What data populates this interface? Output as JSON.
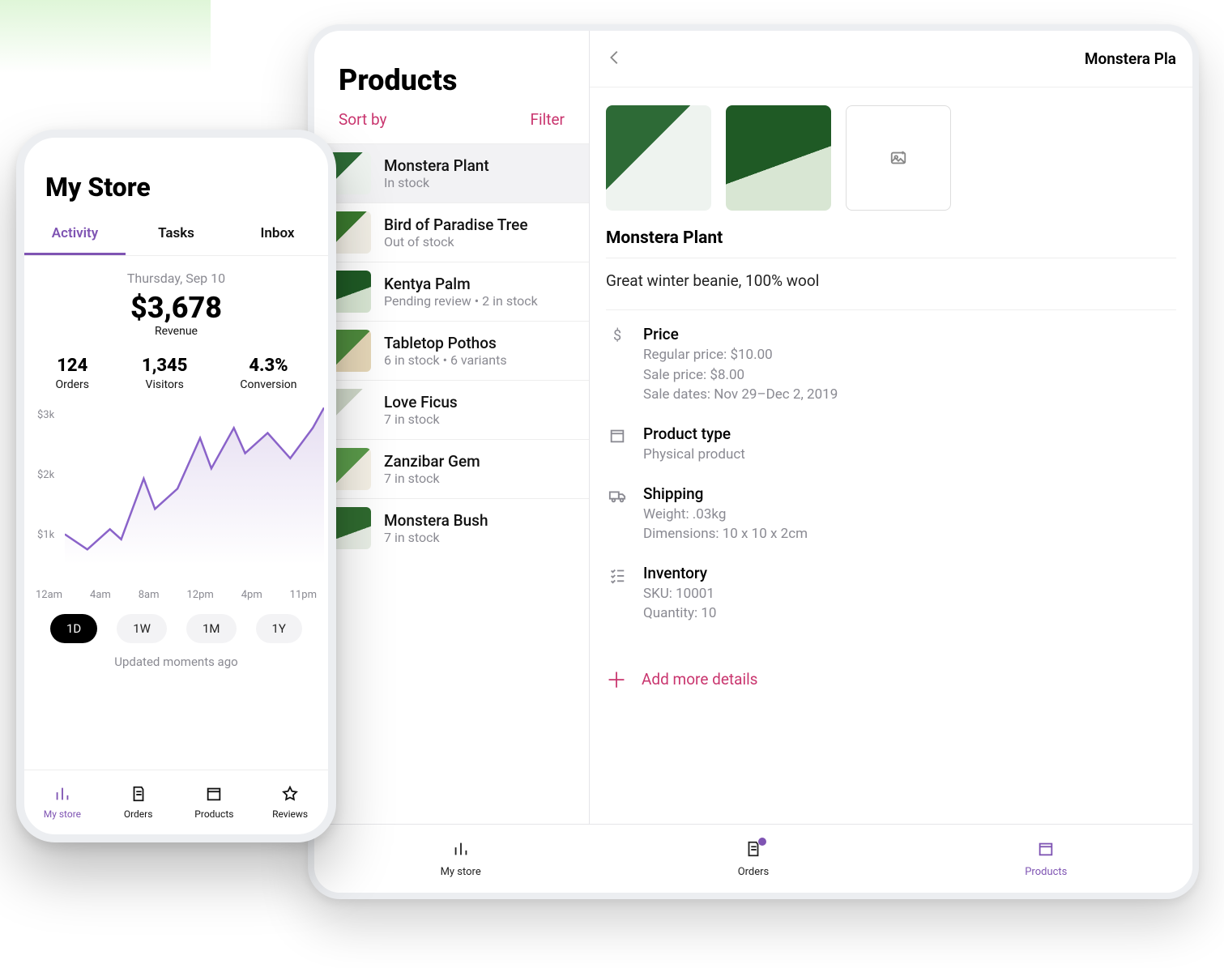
{
  "phone": {
    "title": "My Store",
    "tabs": [
      {
        "label": "Activity",
        "active": true
      },
      {
        "label": "Tasks"
      },
      {
        "label": "Inbox"
      }
    ],
    "date": "Thursday, Sep 10",
    "revenue_value": "$3,678",
    "revenue_label": "Revenue",
    "stats": [
      {
        "value": "124",
        "label": "Orders"
      },
      {
        "value": "1,345",
        "label": "Visitors"
      },
      {
        "value": "4.3%",
        "label": "Conversion"
      }
    ],
    "ranges": [
      {
        "label": "1D",
        "active": true
      },
      {
        "label": "1W"
      },
      {
        "label": "1M"
      },
      {
        "label": "1Y"
      }
    ],
    "updated": "Updated moments ago",
    "nav": [
      {
        "label": "My store",
        "active": true,
        "icon": "bars-icon"
      },
      {
        "label": "Orders",
        "icon": "orders-icon"
      },
      {
        "label": "Products",
        "icon": "products-icon"
      },
      {
        "label": "Reviews",
        "icon": "star-icon"
      }
    ]
  },
  "tablet": {
    "list": {
      "title": "Products",
      "sort": "Sort by",
      "filter": "Filter",
      "items": [
        {
          "name": "Monstera Plant",
          "sub": "In stock",
          "selected": true,
          "c": "c1"
        },
        {
          "name": "Bird of Paradise Tree",
          "sub": "Out of stock",
          "c": "c2"
        },
        {
          "name": "Kentya Palm",
          "sub": "Pending review • 2 in stock",
          "c": "c3"
        },
        {
          "name": "Tabletop Pothos",
          "sub": "6 in stock • 6 variants",
          "c": "c4"
        },
        {
          "name": "Love Ficus",
          "sub": "7 in stock",
          "c": "c5"
        },
        {
          "name": "Zanzibar Gem",
          "sub": "7 in stock",
          "c": "c6"
        },
        {
          "name": "Monstera Bush",
          "sub": "7 in stock",
          "c": "c7"
        }
      ]
    },
    "detail": {
      "header_title": "Monstera Pla",
      "name": "Monstera Plant",
      "desc": "Great winter beanie, 100% wool",
      "sections": {
        "price": {
          "heading": "Price",
          "regular": "Regular price: $10.00",
          "sale": "Sale price: $8.00",
          "dates": "Sale dates: Nov 29–Dec 2, 2019"
        },
        "type": {
          "heading": "Product type",
          "value": "Physical product"
        },
        "shipping": {
          "heading": "Shipping",
          "weight": "Weight: .03kg",
          "dims": "Dimensions: 10 x 10 x 2cm"
        },
        "inventory": {
          "heading": "Inventory",
          "sku": "SKU: 10001",
          "qty": "Quantity: 10"
        }
      },
      "add_more": "Add more details"
    },
    "nav": [
      {
        "label": "My store",
        "icon": "bars-icon"
      },
      {
        "label": "Orders",
        "icon": "orders-icon",
        "badge": true
      },
      {
        "label": "Products",
        "icon": "products-icon",
        "active": true
      }
    ]
  },
  "chart_data": {
    "type": "line",
    "title": "Revenue",
    "xlabel": "",
    "ylabel": "",
    "ylim": [
      0,
      3200
    ],
    "yticks": [
      "$3k",
      "$2k",
      "$1k"
    ],
    "categories": [
      "12am",
      "4am",
      "8am",
      "12pm",
      "4pm",
      "11pm"
    ],
    "x": [
      0,
      2,
      4,
      5,
      7,
      8,
      10,
      12,
      13,
      15,
      16,
      18,
      20,
      22,
      23
    ],
    "values": [
      600,
      300,
      700,
      500,
      1700,
      1100,
      1500,
      2500,
      1900,
      2700,
      2200,
      2600,
      2100,
      2700,
      3100
    ]
  }
}
